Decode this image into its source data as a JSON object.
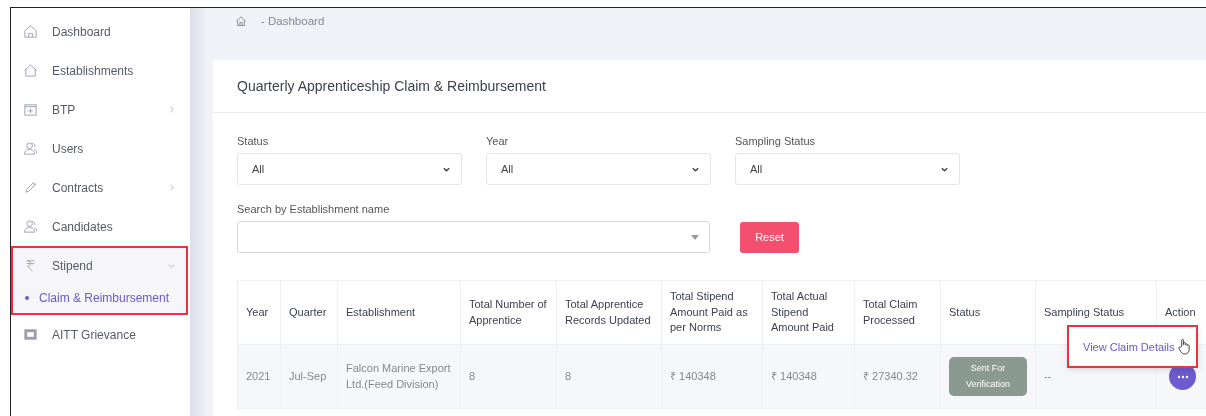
{
  "sidebar": {
    "items": [
      {
        "label": "Dashboard",
        "expandable": false,
        "expanded": false,
        "highlighted": false
      },
      {
        "label": "Establishments",
        "expandable": false,
        "expanded": false,
        "highlighted": false
      },
      {
        "label": "BTP",
        "expandable": true,
        "expanded": false,
        "highlighted": false
      },
      {
        "label": "Users",
        "expandable": false,
        "expanded": false,
        "highlighted": false
      },
      {
        "label": "Contracts",
        "expandable": true,
        "expanded": false,
        "highlighted": false
      },
      {
        "label": "Candidates",
        "expandable": false,
        "expanded": false,
        "highlighted": false
      },
      {
        "label": "Stipend",
        "expandable": true,
        "expanded": true,
        "highlighted": true,
        "children": [
          {
            "label": "Claim & Reimbursement",
            "selected": true
          }
        ]
      },
      {
        "label": "AITT Grievance",
        "expandable": false,
        "expanded": false,
        "highlighted": false
      }
    ]
  },
  "breadcrumb": {
    "current": "- Dashboard"
  },
  "card": {
    "title": "Quarterly Apprenticeship Claim & Reimbursement",
    "filters": [
      {
        "label": "Status",
        "value": "All"
      },
      {
        "label": "Year",
        "value": "All"
      },
      {
        "label": "Sampling Status",
        "value": "All"
      }
    ],
    "search": {
      "label": "Search by Establishment name"
    },
    "reset_button": "Reset",
    "table": {
      "columns": [
        "Year",
        "Quarter",
        "Establishment",
        "Total Number of Apprentice",
        "Total Apprentice Records Updated",
        "Total Stipend Amount Paid as per Norms",
        "Total Actual Stipend Amount Paid",
        "Total Claim Processed",
        "Status",
        "Sampling Status",
        "Action"
      ],
      "rows": [
        {
          "cells": [
            "2021",
            "Jul-Sep",
            "Falcon Marine Export Ltd.(Feed Division)",
            "8",
            "8",
            "₹ 140348",
            "₹ 140348",
            "₹ 27340.32"
          ],
          "status": "Sent For Verification",
          "sampling_status": "--"
        }
      ]
    },
    "action_menu": {
      "items": [
        "View Claim Details"
      ],
      "highlighted": true
    }
  }
}
